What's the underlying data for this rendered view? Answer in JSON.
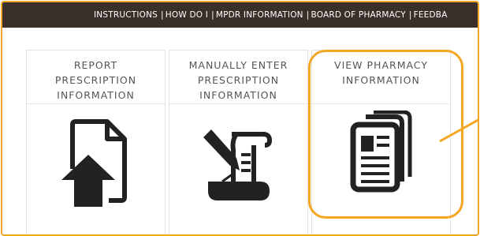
{
  "nav": {
    "items": [
      "INSTRUCTIONS",
      "HOW DO I",
      "MPDR INFORMATION",
      "BOARD OF PHARMACY",
      "FEEDBA"
    ],
    "separator": "|"
  },
  "cards": [
    {
      "title_lines": [
        "REPORT",
        "PRESCRIPTION",
        "INFORMATION"
      ],
      "icon": "upload-document-icon"
    },
    {
      "title_lines": [
        "MANUALLY ENTER",
        "PRESCRIPTION",
        "INFORMATION"
      ],
      "icon": "pen-on-scroll-icon"
    },
    {
      "title_lines": [
        "VIEW PHARMACY",
        "INFORMATION"
      ],
      "icon": "documents-icon"
    }
  ],
  "colors": {
    "nav_background": "#3b2f2a",
    "highlight": "#f5a623",
    "icon": "#222222",
    "title_text": "#555555"
  }
}
